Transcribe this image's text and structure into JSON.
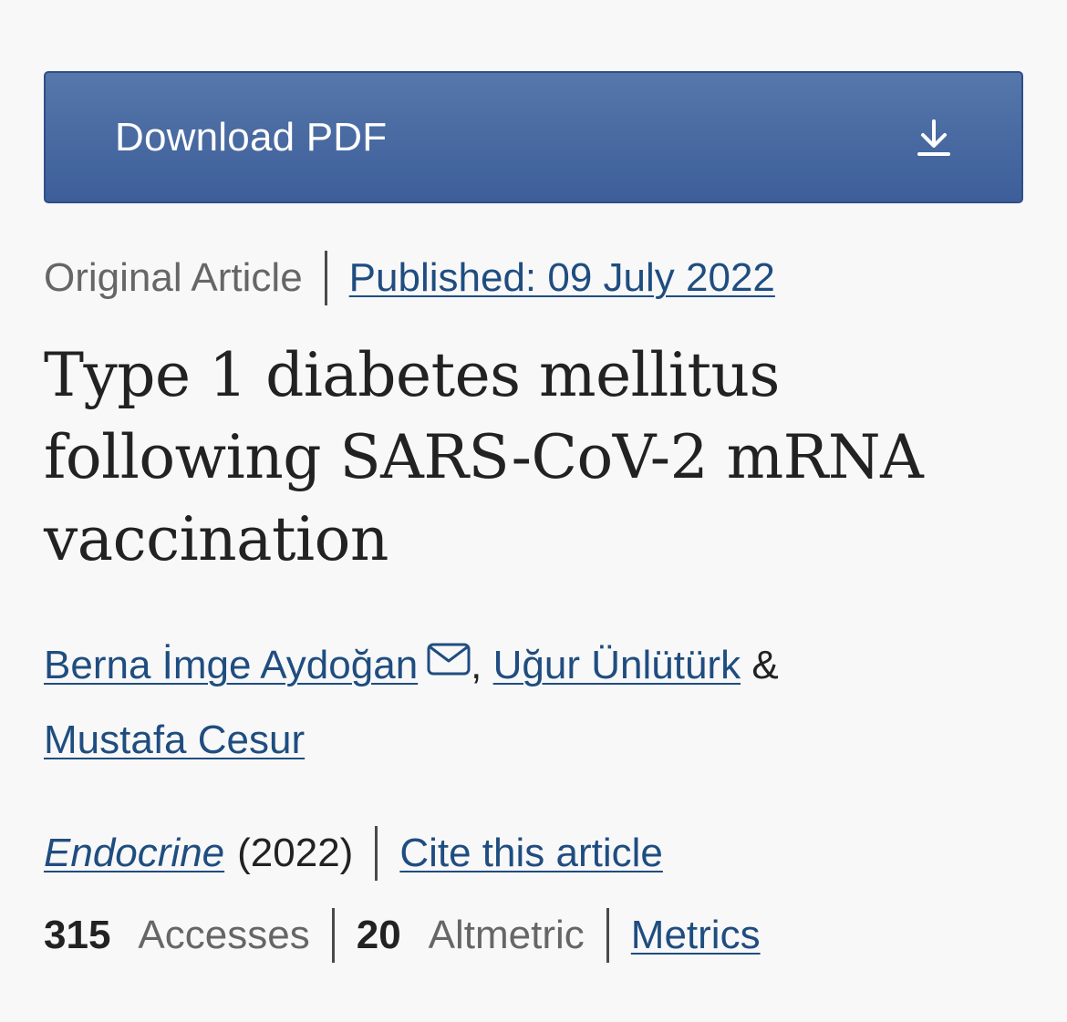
{
  "download": {
    "label": "Download PDF",
    "icon": "download-icon"
  },
  "meta": {
    "article_type": "Original Article",
    "published": "Published: 09 July 2022"
  },
  "title": "Type 1 diabetes mellitus following SARS-CoV-2 mRNA vaccination",
  "authors": [
    {
      "name": "Berna İmge Aydoğan",
      "icon": "mail-icon"
    },
    {
      "name": "Uğur Ünlütürk"
    },
    {
      "name": "Mustafa Cesur"
    }
  ],
  "author_separators": {
    "comma": ",",
    "ampersand": "&"
  },
  "journal": {
    "name": "Endocrine",
    "year": "(2022)",
    "cite": "Cite this article"
  },
  "metrics": {
    "accesses_count": "315",
    "accesses_label": "Accesses",
    "altmetric_count": "20",
    "altmetric_label": "Altmetric",
    "metrics_link": "Metrics"
  },
  "colors": {
    "button": "#4a6aa1",
    "link": "#1f4d80",
    "muted_text": "#666666",
    "background": "#f8f8f8"
  }
}
